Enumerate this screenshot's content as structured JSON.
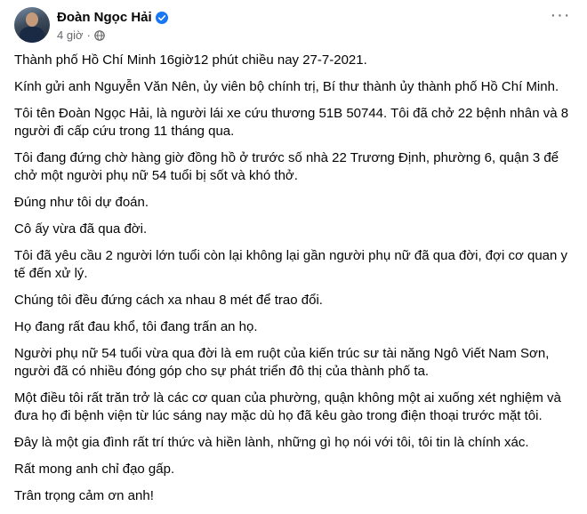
{
  "post": {
    "author": "Đoàn Ngọc Hải",
    "timestamp": "4 giờ",
    "separator": "·",
    "icons": {
      "verified": "verified-badge-icon",
      "audience": "globe-icon",
      "more": "more-options-icon"
    },
    "more_label": "···",
    "colors": {
      "verified_badge": "#1877f2",
      "secondary_text": "#65676b",
      "primary_text": "#050505"
    },
    "paragraphs": [
      "Thành phố Hồ Chí Minh 16giờ12 phút chiều nay 27-7-2021.",
      "Kính gửi anh Nguyễn Văn Nên, ủy viên bộ chính trị, Bí thư thành ủy thành phố Hồ Chí Minh.",
      "Tôi tên Đoàn Ngọc Hải, là người lái xe cứu thương 51B 50744. Tôi đã chở 22 bệnh nhân và 8 người đi cấp cứu trong 11 tháng qua.",
      "Tôi đang đứng chờ hàng giờ đồng hồ ở trước số nhà 22 Trương Định, phường 6, quận 3 để chở một người phụ nữ 54 tuổi bị sốt và khó thở.",
      "Đúng như tôi dự đoán.",
      "Cô ấy vừa đã qua đời.",
      "Tôi đã yêu cầu 2 người lớn tuổi còn lại không lại gần người phụ nữ đã qua đời, đợi cơ quan y tế đến xử lý.",
      "Chúng tôi đều đứng cách xa nhau 8 mét để trao đổi.",
      "Họ đang rất đau khổ, tôi đang trấn an họ.",
      "Người phụ nữ 54 tuổi vừa qua đời là em ruột của kiến trúc sư tài năng Ngô Viết Nam Sơn, người đã có nhiều đóng góp cho sự phát triển đô thị của thành phố ta.",
      "Một điều tôi rất trăn trở là các cơ quan của phường, quận không một ai xuống xét nghiệm và đưa họ đi bệnh viện từ lúc sáng nay mặc dù họ đã kêu gào trong điện thoại trước mặt tôi.",
      "Đây là một gia đình rất trí thức và hiền lành, những gì họ nói với tôi, tôi tin là chính xác.",
      "Rất mong anh chỉ đạo gấp.",
      "Trân trọng cảm ơn anh!"
    ]
  }
}
